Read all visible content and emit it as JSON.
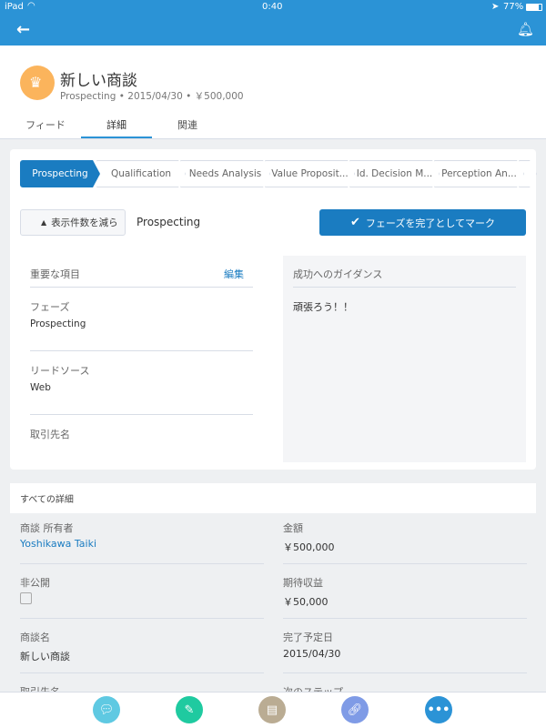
{
  "status_bar": {
    "device": "iPad",
    "time": "0:40",
    "battery": "77%"
  },
  "header": {
    "title": "新しい商談",
    "stage": "Prospecting",
    "date": "2015/04/30",
    "amount": "￥500,000",
    "avatar_color": "#fbb45c"
  },
  "tabs": [
    {
      "label": "フィード"
    },
    {
      "label": "詳細",
      "active": true
    },
    {
      "label": "関連"
    }
  ],
  "path": {
    "steps": [
      "Prospecting",
      "Qualification",
      "Needs Analysis",
      "Value Proposit...",
      "Id. Decision M...",
      "Perception An..."
    ],
    "current": "Prospecting"
  },
  "actions": {
    "collapse_label": "表示件数を減ら",
    "current_stage": "Prospecting",
    "mark_complete_label": "フェーズを完了としてマーク"
  },
  "key_fields": {
    "title": "重要な項目",
    "edit_label": "編集",
    "fields": [
      {
        "label": "フェーズ",
        "value": "Prospecting"
      },
      {
        "label": "リードソース",
        "value": "Web"
      },
      {
        "label": "取引先名",
        "value": ""
      }
    ]
  },
  "guidance": {
    "title": "成功へのガイダンス",
    "text": "頑張ろう！！"
  },
  "all_details": {
    "title": "すべての詳細",
    "left": [
      {
        "label": "商談 所有者",
        "value": "Yoshikawa Taiki"
      },
      {
        "label": "非公開",
        "value": ""
      },
      {
        "label": "商談名",
        "value": "新しい商談"
      },
      {
        "label": "取引先名",
        "value": ""
      }
    ],
    "right": [
      {
        "label": "金額",
        "value": "￥500,000"
      },
      {
        "label": "期待収益",
        "value": "￥50,000"
      },
      {
        "label": "完了予定日",
        "value": "2015/04/30"
      },
      {
        "label": "次のステップ",
        "value": ""
      }
    ]
  },
  "bottom_actions": [
    {
      "name": "post",
      "color": "#5fc9e2"
    },
    {
      "name": "edit",
      "color": "#1fcaa0"
    },
    {
      "name": "file",
      "color": "#baac93"
    },
    {
      "name": "link",
      "color": "#7f9be6"
    },
    {
      "name": "more",
      "color": "#2b93d6"
    }
  ]
}
